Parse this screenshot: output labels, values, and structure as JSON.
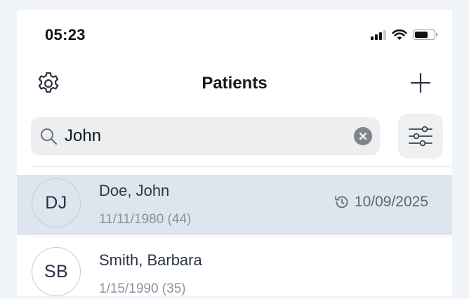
{
  "status_bar": {
    "time": "05:23",
    "icons": [
      "cellular-signal-icon",
      "wifi-icon",
      "battery-icon"
    ]
  },
  "nav": {
    "title": "Patients",
    "left_icon": "gear-icon",
    "right_icon": "plus-icon"
  },
  "search": {
    "value": "John",
    "icon": "search-icon",
    "clear_icon": "clear-icon",
    "filter_icon": "sliders-icon"
  },
  "patients": [
    {
      "initials": "DJ",
      "name": "Doe, John",
      "dob": "11/11/1980 (44)",
      "last_visit": "10/09/2025",
      "visit_icon": "history-icon",
      "selected": true
    },
    {
      "initials": "SB",
      "name": "Smith, Barbara",
      "dob": "1/15/1990 (35)",
      "selected": false
    }
  ],
  "colors": {
    "selected_row": "#dde6ef",
    "search_bg": "#eceef0",
    "text_primary": "#2b3646",
    "text_secondary": "#8a929c"
  }
}
